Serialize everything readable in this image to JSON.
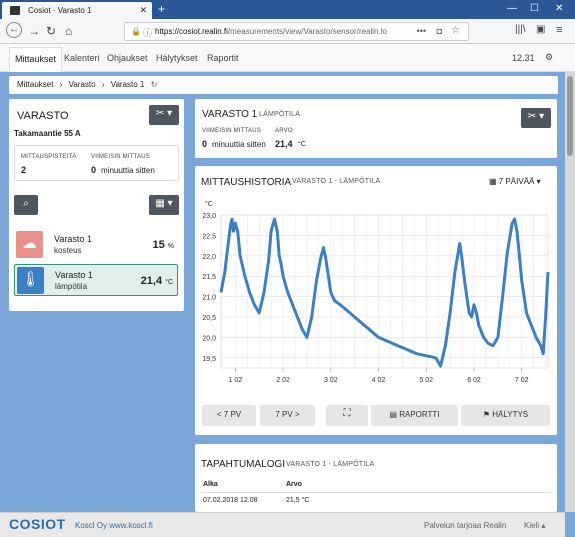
{
  "browser": {
    "tab_title": "Cosiot · Varasto 1",
    "url_host": "https://cosiot.realin.fi",
    "url_path": "/measurements/view/Varasto/sensor/realin.lo"
  },
  "appnav": {
    "items": [
      "Mittaukset",
      "Kalenteri",
      "Ohjaukset",
      "Hälytykset",
      "Raportit"
    ],
    "time": "12.31"
  },
  "breadcrumb": [
    "Mittaukset",
    "Varasto",
    "Varasto 1"
  ],
  "location": {
    "title": "VARASTO",
    "address": "Takamaantie 55 A",
    "points_label": "MITTAUSPISTEITÄ",
    "points_value": "2",
    "last_label": "VIIMEISIN MITTAUS",
    "last_value": "0",
    "last_unit": "minuuttia sitten"
  },
  "sensors": [
    {
      "name": "Varasto 1",
      "kind": "kosteus",
      "value": "15",
      "unit": "%"
    },
    {
      "name": "Varasto 1",
      "kind": "lämpötila",
      "value": "21,4",
      "unit": "°C"
    }
  ],
  "current": {
    "title": "VARASTO 1",
    "subtitle": "LÄMPÖTILA",
    "last_label": "VIIMEISIN MITTAUS",
    "last_value": "0",
    "last_unit": "minuuttia sitten",
    "value_label": "ARVO",
    "value": "21,4",
    "value_unit": "°C"
  },
  "history": {
    "title": "MITTAUSHISTORIA",
    "subtitle": "VARASTO 1 - LÄMPÖTILA",
    "range": "7 PÄIVÄÄ",
    "buttons": {
      "prev": "< 7 PV",
      "next": "7 PV >",
      "report": "RAPORTTI",
      "alarms": "HÄLYTYS"
    }
  },
  "chart_data": {
    "type": "line",
    "ylabel": "°C",
    "ylim": [
      19.25,
      23.0
    ],
    "yticks": [
      "23,0",
      "22,5",
      "22,0",
      "21,5",
      "21,0",
      "20,5",
      "20,0",
      "19,5"
    ],
    "xticks": [
      "1 02",
      "2 02",
      "3 02",
      "4 02",
      "5 02",
      "6 02",
      "7 02"
    ],
    "x_start_day": 0.7,
    "x_end_day": 7.55,
    "series": [
      {
        "x": [
          0.7,
          0.78,
          0.85,
          0.9,
          0.93,
          0.96,
          1.0,
          1.05,
          1.1,
          1.2,
          1.3,
          1.4,
          1.5,
          1.6,
          1.7,
          1.75,
          1.82,
          1.88,
          1.92,
          1.96,
          2.0,
          2.05,
          2.1,
          2.2,
          2.3,
          2.4,
          2.5,
          2.6,
          2.7,
          2.8,
          2.85,
          2.9,
          2.95,
          3.0,
          3.08,
          3.2,
          3.4,
          3.6,
          3.8,
          4.0,
          4.2,
          4.4,
          4.6,
          4.8,
          5.0,
          5.2,
          5.3,
          5.4,
          5.5,
          5.6,
          5.7,
          5.74,
          5.8,
          5.85,
          5.9,
          5.95,
          6.0,
          6.05,
          6.1,
          6.2,
          6.3,
          6.4,
          6.5,
          6.6,
          6.7,
          6.8,
          6.85,
          6.9,
          6.95,
          7.0,
          7.05,
          7.1,
          7.2,
          7.3,
          7.4,
          7.45,
          7.5,
          7.55
        ],
        "y": [
          21.1,
          21.6,
          22.3,
          22.75,
          22.9,
          22.6,
          22.8,
          22.6,
          22.0,
          21.5,
          21.1,
          20.8,
          20.6,
          21.1,
          21.9,
          22.6,
          22.9,
          22.6,
          22.0,
          21.8,
          21.5,
          21.3,
          21.1,
          20.8,
          20.5,
          20.2,
          20.0,
          20.5,
          21.4,
          22.0,
          22.2,
          21.9,
          21.5,
          21.1,
          20.9,
          20.8,
          20.6,
          20.4,
          20.2,
          20.0,
          19.9,
          19.8,
          19.7,
          19.6,
          19.55,
          19.5,
          19.3,
          19.8,
          20.6,
          21.6,
          22.3,
          22.0,
          21.4,
          21.0,
          20.6,
          20.5,
          20.8,
          20.6,
          20.3,
          20.0,
          19.85,
          19.8,
          20.0,
          21.0,
          22.1,
          22.8,
          22.9,
          22.6,
          22.0,
          21.4,
          21.0,
          20.6,
          20.3,
          20.0,
          19.8,
          19.6,
          20.5,
          21.6
        ]
      }
    ]
  },
  "events": {
    "title": "TAPAHTUMALOGI",
    "subtitle": "VARASTO 1 - LÄMPÖTILA",
    "columns": [
      "Alka",
      "Arvo"
    ],
    "rows": [
      [
        "07.02.2018 12.08",
        "21,5 °C"
      ]
    ]
  },
  "footer": {
    "brand": "COSIOT",
    "org": "Koscl Oy  www.koscl.fi",
    "provider": "Palvelun tarjoaa Realin",
    "lang": "Kieli"
  },
  "colors": {
    "accent": "#2b6fa8",
    "line": "#3b7fc4",
    "humid": "#e8908a",
    "temp": "#3b7fc4",
    "selected_bg": "#dff0ec"
  }
}
